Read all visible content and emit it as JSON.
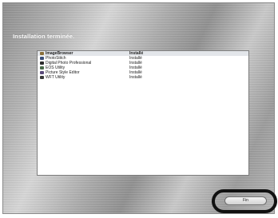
{
  "dialog": {
    "title": "Installation terminée."
  },
  "install_list": {
    "rows": [
      {
        "name": "ImageBrowser",
        "status": "Installé",
        "icon": "imagebrowser-icon",
        "color": "#8a6f3a"
      },
      {
        "name": "PhotoStitch",
        "status": "Installé",
        "icon": "photostitch-icon",
        "color": "#3a4f7a"
      },
      {
        "name": "Digital Photo Professional",
        "status": "Installé",
        "icon": "dpp-icon",
        "color": "#2b2b2b"
      },
      {
        "name": "EOS Utility",
        "status": "Installé",
        "icon": "eos-utility-icon",
        "color": "#4a6a4a"
      },
      {
        "name": "Picture Style Editor",
        "status": "Installé",
        "icon": "picture-style-editor-icon",
        "color": "#5a4a7a"
      },
      {
        "name": "WFT Utility",
        "status": "Installé",
        "icon": "wft-utility-icon",
        "color": "#3a3a3a"
      }
    ]
  },
  "buttons": {
    "finish_label": "Fin"
  }
}
